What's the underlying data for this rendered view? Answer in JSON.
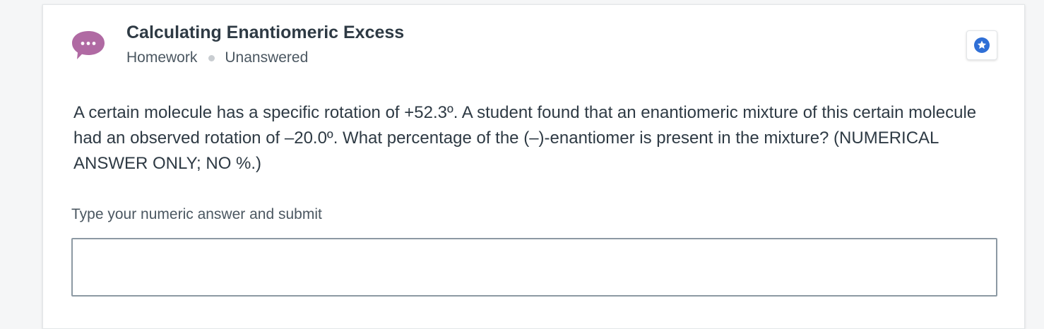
{
  "header": {
    "title": "Calculating Enantiomeric Excess",
    "category": "Homework",
    "status": "Unanswered"
  },
  "icons": {
    "avatar": "chat-bubble-ellipsis-icon",
    "favorite": "star-icon"
  },
  "question": {
    "text": "A certain molecule has a specific rotation of +52.3º. A student found that an enantiomeric mixture of this certain molecule had an observed rotation of –20.0º. What percentage of the (–)-enantiomer is present in the mixture? (NUMERICAL ANSWER ONLY; NO %.)"
  },
  "answer": {
    "prompt": "Type your numeric answer and submit",
    "value": ""
  },
  "colors": {
    "avatar": "#b06aa3",
    "star": "#2f6fd6",
    "text": "#2e3a44",
    "muted": "#4b5761",
    "input_border": "#8c99a3"
  }
}
